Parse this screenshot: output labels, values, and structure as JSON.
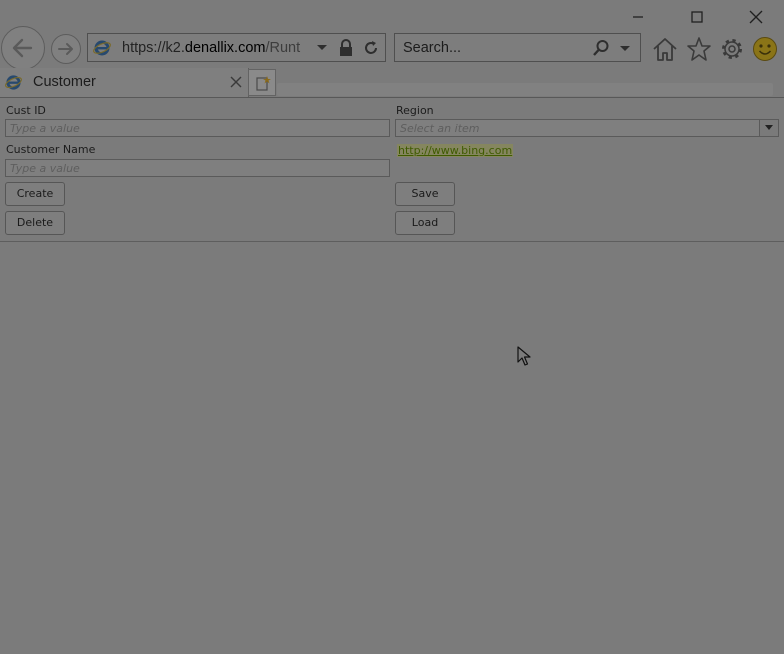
{
  "window": {
    "minimize_icon": "minimize-icon",
    "maximize_icon": "maximize-icon",
    "close_icon": "close-icon"
  },
  "toolbar": {
    "address_prefix": "https://k2.",
    "address_domain": "denallix.com",
    "address_suffix": "/Runt",
    "search_placeholder": "Search..."
  },
  "tab": {
    "title": "Customer"
  },
  "form": {
    "cust_id_label": "Cust ID",
    "cust_id_placeholder": "Type a value",
    "region_label": "Region",
    "region_placeholder": "Select an item",
    "customer_name_label": "Customer Name",
    "customer_name_placeholder": "Type a value",
    "link_text": "http://www.bing.com",
    "create_label": "Create",
    "save_label": "Save",
    "delete_label": "Delete",
    "load_label": "Load"
  },
  "colors": {
    "overlay_background": "#7b7b7b",
    "link": "#3f5b00"
  }
}
